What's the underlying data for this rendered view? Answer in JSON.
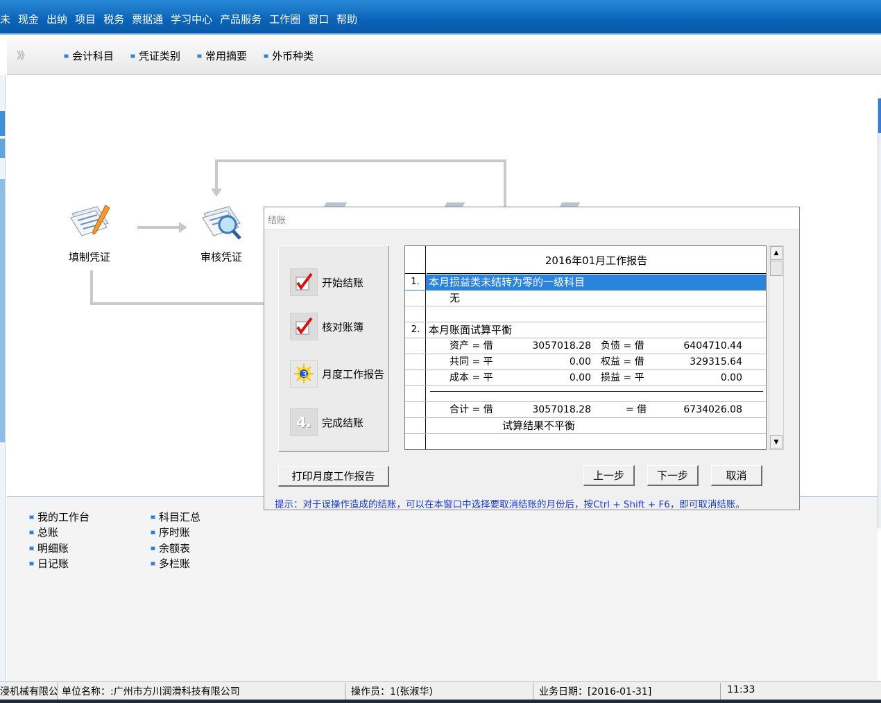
{
  "menu": [
    "未",
    "现金",
    "出纳",
    "项目",
    "税务",
    "票据通",
    "学习中心",
    "产品服务",
    "工作圈",
    "窗口",
    "帮助"
  ],
  "toolbar": {
    "chevron": "》》",
    "items": [
      "会计科目",
      "凭证类别",
      "常用摘要",
      "外币种类"
    ]
  },
  "flow": {
    "nodes": [
      "填制凭证",
      "审核凭证"
    ]
  },
  "dialog": {
    "title": "结账",
    "steps": [
      {
        "label": "开始结账",
        "glyph": "check-icon"
      },
      {
        "label": "核对账簿",
        "glyph": "check-icon"
      },
      {
        "label": "月度工作报告",
        "glyph": "report-icon"
      },
      {
        "label": "完成结账",
        "glyph": "4."
      }
    ],
    "step4_glyph": "4.",
    "report": {
      "header": "2016年01月工作报告",
      "sec1_num": "1.",
      "sec1_title": "本月损益类未结转为零的一级科目",
      "sec1_value": "无",
      "sec2_num": "2.",
      "sec2_title": "本月账面试算平衡",
      "rows": [
        {
          "l1": "资产 = 借",
          "v1": "3057018.28",
          "l2": "负债 = 借",
          "v2": "6404710.44"
        },
        {
          "l1": "共同 = 平",
          "v1": "0.00",
          "l2": "权益 = 借",
          "v2": "329315.64"
        },
        {
          "l1": "成本 = 平",
          "v1": "0.00",
          "l2": "损益 = 平",
          "v2": "0.00"
        }
      ],
      "total": {
        "l1": "合计 = 借",
        "v1": "3057018.28",
        "l2": "= 借",
        "v2": "6734026.08"
      },
      "result": "试算结果不平衡"
    },
    "buttons": {
      "print": "打印月度工作报告",
      "prev": "上一步",
      "next": "下一步",
      "cancel": "取消"
    },
    "hint": "提示：对于误操作造成的结账，可以在本窗口中选择要取消结账的月份后，按Ctrl + Shift + F6，即可取消结账。"
  },
  "links": {
    "col1": [
      "我的工作台",
      "总账",
      "明细账",
      "日记账"
    ],
    "col2": [
      "科目汇总",
      "序时账",
      "余额表",
      "多栏账"
    ]
  },
  "status": {
    "company_short": "浸机械有限公",
    "unit": "单位名称：:广州市方川润滑科技有限公司",
    "operator": "操作员：1(张淑华)",
    "date": "业务日期：[2016-01-31]",
    "time": "11:33"
  }
}
